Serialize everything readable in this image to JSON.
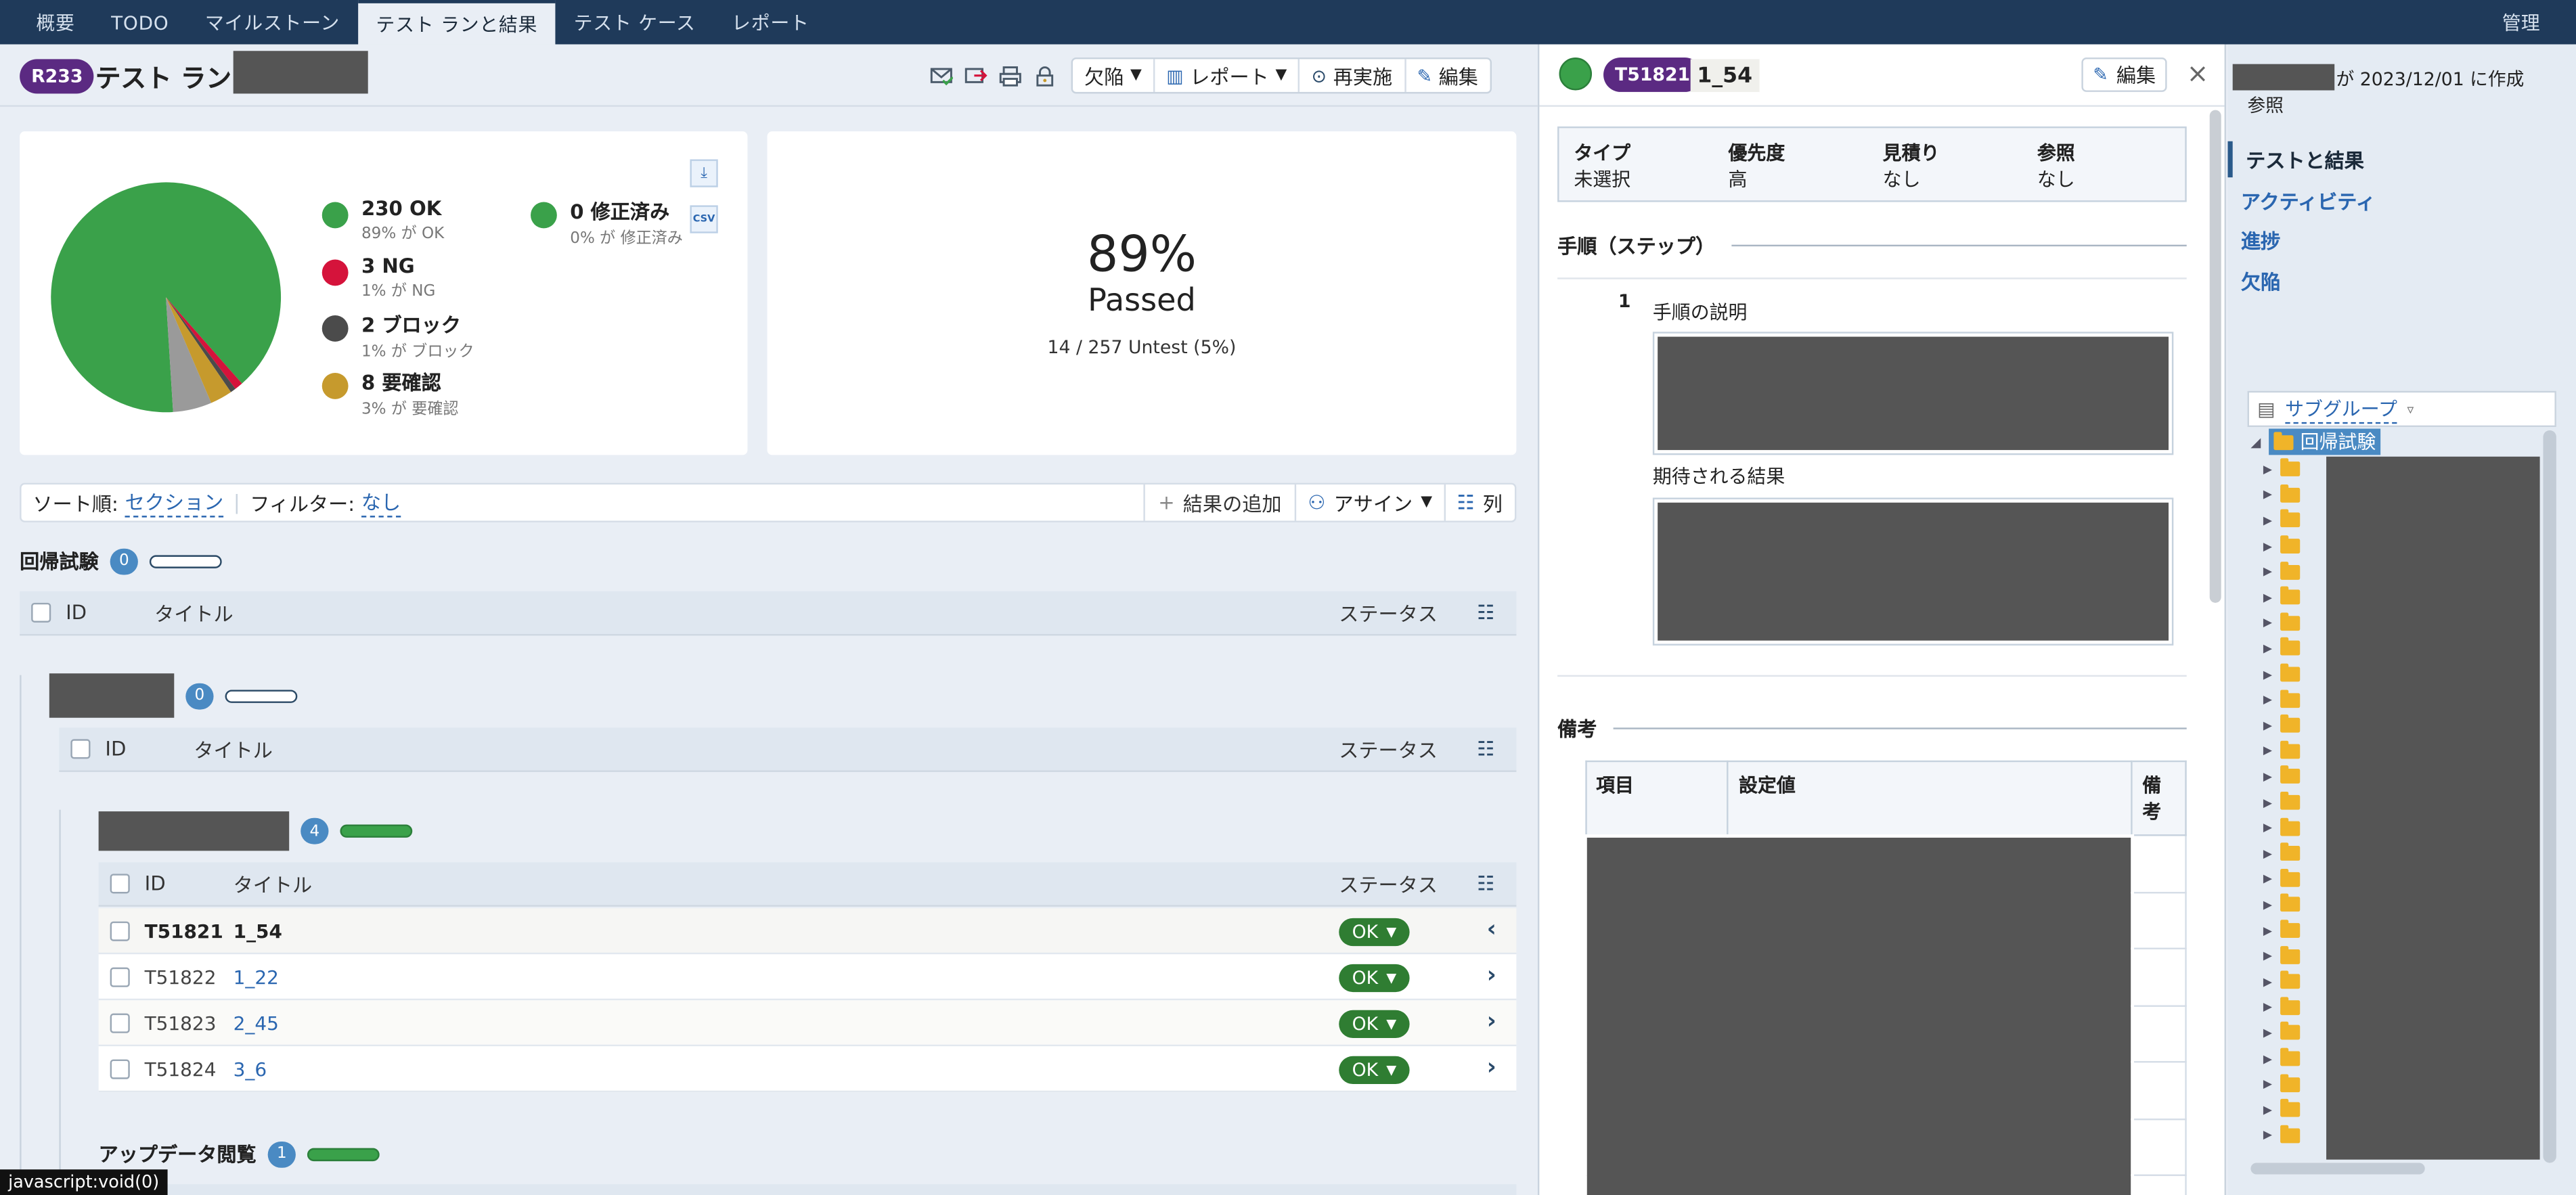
{
  "nav": {
    "tabs": [
      "概要",
      "TODO",
      "マイルストーン",
      "テスト ランと結果",
      "テスト ケース",
      "レポート"
    ],
    "active_index": 3,
    "admin": "管理"
  },
  "run": {
    "id": "R233",
    "title": "テスト ラン",
    "buttons": {
      "defects": "欠陥",
      "report": "レポート",
      "rerun": "再実施",
      "edit": "編集"
    }
  },
  "icons": [
    "mail-check-icon",
    "export-icon",
    "print-icon",
    "lock-icon",
    "chart-download-icon",
    "csv-download-icon"
  ],
  "colors": {
    "ok": "#3aa14a",
    "ng": "#d5133b",
    "blocked": "#4b4b4b",
    "review": "#c69a2d",
    "untested": "#9a9a9a",
    "accent": "#5b2a82",
    "topbar": "#1f3a5a"
  },
  "chart_data": {
    "type": "pie",
    "categories": [
      "OK",
      "NG",
      "ブロック",
      "要確認",
      "修正済み",
      "Untest"
    ],
    "values": [
      230,
      3,
      2,
      8,
      0,
      14
    ],
    "colors": [
      "#3aa14a",
      "#d5133b",
      "#4b4b4b",
      "#c69a2d",
      "#3aa14a",
      "#9a9a9a"
    ]
  },
  "legend": [
    {
      "name": "230 OK",
      "sub": "89% が OK",
      "color": "#3aa14a"
    },
    {
      "name": "3 NG",
      "sub": "1% が NG",
      "color": "#d5133b"
    },
    {
      "name": "2 ブロック",
      "sub": "1% が ブロック",
      "color": "#4b4b4b"
    },
    {
      "name": "8 要確認",
      "sub": "3% が 要確認",
      "color": "#c69a2d"
    },
    {
      "name": "0 修正済み",
      "sub": "0% が 修正済み",
      "color": "#3aa14a"
    }
  ],
  "summary": {
    "percent": "89%",
    "label": "Passed",
    "untest": "14 / 257 Untest (5%)"
  },
  "sortbar": {
    "sort_label": "ソート順:",
    "sort_value": "セクション",
    "filter_label": "フィルター:",
    "filter_value": "なし",
    "add_result": "結果の追加",
    "assign": "アサイン",
    "columns": "列"
  },
  "sections": {
    "regression": {
      "title": "回帰試験",
      "count": "0"
    },
    "sub1": {
      "count": "0"
    },
    "sub2": {
      "count": "4"
    },
    "app": {
      "title": "アップデータ閲覧",
      "count": "1"
    }
  },
  "table": {
    "col_id": "ID",
    "col_title": "タイトル",
    "col_status": "ステータス",
    "rows": [
      {
        "id": "T51821",
        "title": "1_54",
        "status": "OK",
        "chev": "‹"
      },
      {
        "id": "T51822",
        "title": "1_22",
        "status": "OK",
        "chev": "›"
      },
      {
        "id": "T51823",
        "title": "2_45",
        "status": "OK",
        "chev": "›"
      },
      {
        "id": "T51824",
        "title": "3_6",
        "status": "OK",
        "chev": "›"
      }
    ]
  },
  "detail": {
    "id": "T51821",
    "title": "1_54",
    "edit": "編集",
    "close": "×",
    "fields": [
      {
        "k": "タイプ",
        "v": "未選択"
      },
      {
        "k": "優先度",
        "v": "高"
      },
      {
        "k": "見積り",
        "v": "なし"
      },
      {
        "k": "参照",
        "v": "なし"
      }
    ],
    "steps_title": "手順（ステップ）",
    "step_no": "1",
    "step_desc": "手順の説明",
    "expected": "期待される結果",
    "notes_title": "備考",
    "notes_cols": [
      "項目",
      "設定値",
      "備考"
    ]
  },
  "sidebar": {
    "created": "が 2023/12/01 に作成",
    "ref": "参照",
    "items": [
      "テストと結果",
      "アクティビティ",
      "進捗",
      "欠陥"
    ],
    "subgroup": "サブグループ",
    "root_folder": "回帰試験"
  },
  "status_bar": "javascript:void(0)"
}
